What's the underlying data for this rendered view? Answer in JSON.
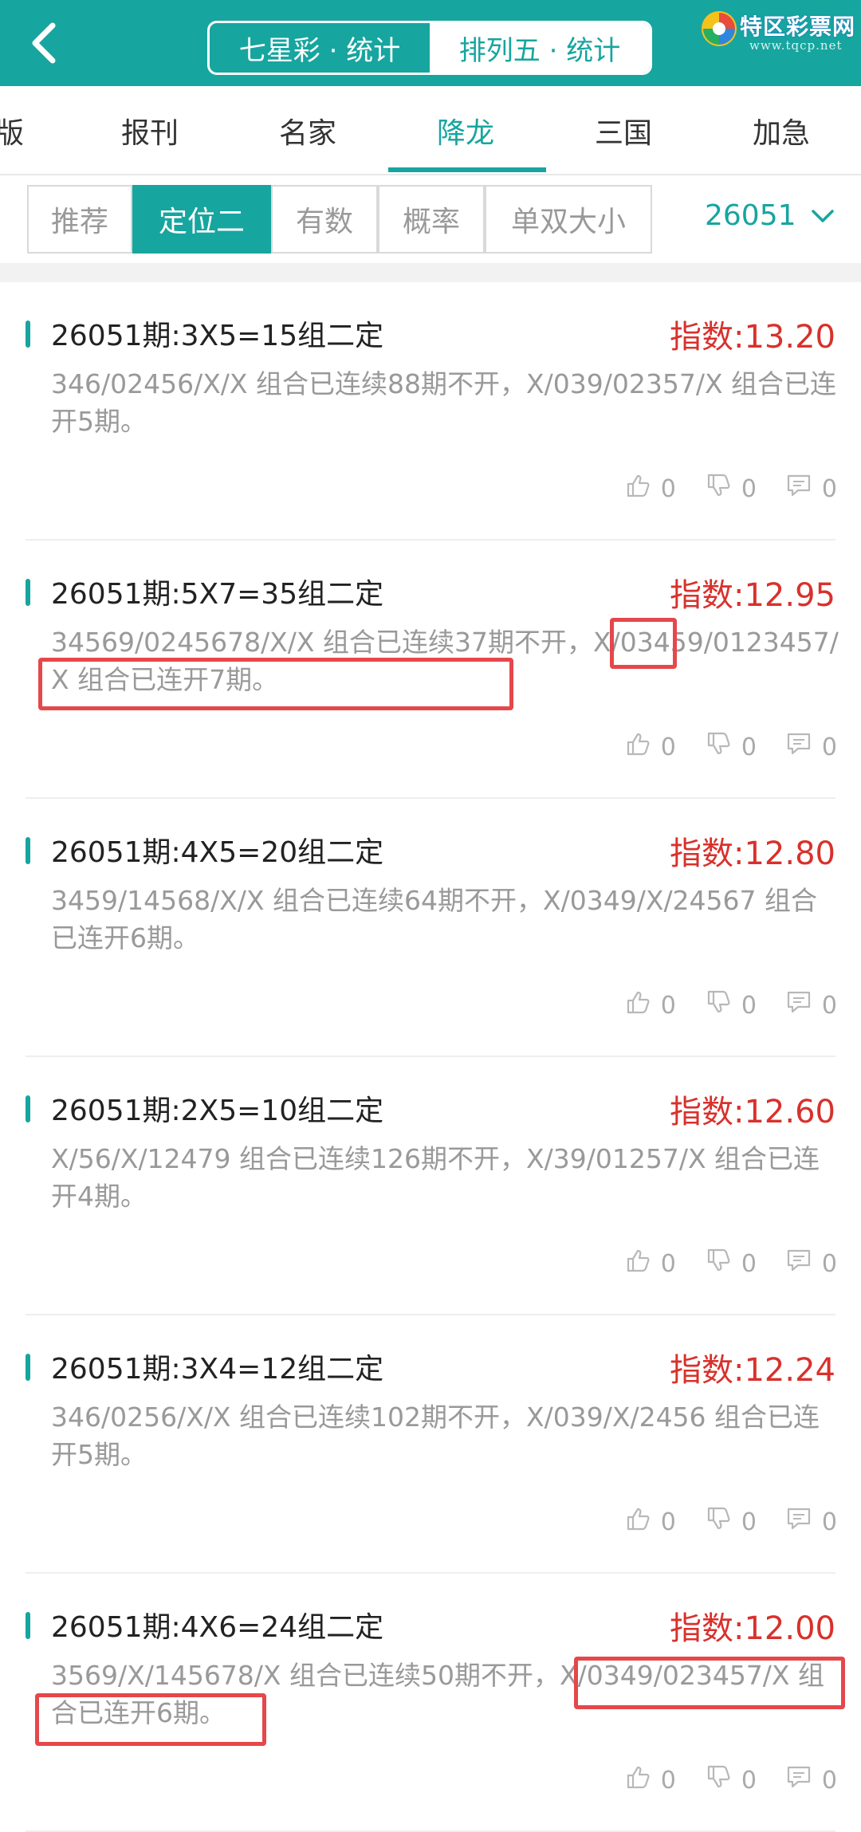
{
  "header": {
    "back_icon": "chevron-left-icon",
    "segments": [
      "七星彩 · 统计",
      "排列五 · 统计"
    ],
    "active_segment": 1,
    "logo": {
      "brand": "特区彩票网",
      "site": "www.tqcp.net"
    },
    "bg_color": "#17a59f"
  },
  "tabs": [
    "版",
    "报刊",
    "名家",
    "降龙",
    "三国",
    "加急"
  ],
  "active_tab": 3,
  "filters": [
    "推荐",
    "定位二",
    "有数",
    "概率",
    "单双大小"
  ],
  "active_filter": 1,
  "issue_select": {
    "value": "26051",
    "icon": "chevron-down-icon"
  },
  "cards": [
    {
      "title": "26051期:3X5=15组二定",
      "index": "指数:13.20",
      "desc": "346/02456/X/X 组合已连续88期不开，X/039/02357/X 组合已连开5期。",
      "likes": "0",
      "dislikes": "0",
      "comments": "0"
    },
    {
      "title": "26051期:5X7=35组二定",
      "index": "指数:12.95",
      "desc": "34569/0245678/X/X 组合已连续37期不开，X/03459/0123457/X 组合已连开7期。",
      "likes": "0",
      "dislikes": "0",
      "comments": "0"
    },
    {
      "title": "26051期:4X5=20组二定",
      "index": "指数:12.80",
      "desc": "3459/14568/X/X 组合已连续64期不开，X/0349/X/24567 组合已连开6期。",
      "likes": "0",
      "dislikes": "0",
      "comments": "0"
    },
    {
      "title": "26051期:2X5=10组二定",
      "index": "指数:12.60",
      "desc": "X/56/X/12479 组合已连续126期不开，X/39/01257/X 组合已连开4期。",
      "likes": "0",
      "dislikes": "0",
      "comments": "0"
    },
    {
      "title": "26051期:3X4=12组二定",
      "index": "指数:12.24",
      "desc": "346/0256/X/X 组合已连续102期不开，X/039/X/2456 组合已连开5期。",
      "likes": "0",
      "dislikes": "0",
      "comments": "0"
    },
    {
      "title": "26051期:4X6=24组二定",
      "index": "指数:12.00",
      "desc": "3569/X/145678/X 组合已连续50期不开，X/0349/023457/X 组合已连开6期。",
      "likes": "0",
      "dislikes": "0",
      "comments": "0"
    }
  ],
  "colors": {
    "accent": "#17a59f",
    "index_red": "#d8312c",
    "highlight": "#e5474b"
  }
}
